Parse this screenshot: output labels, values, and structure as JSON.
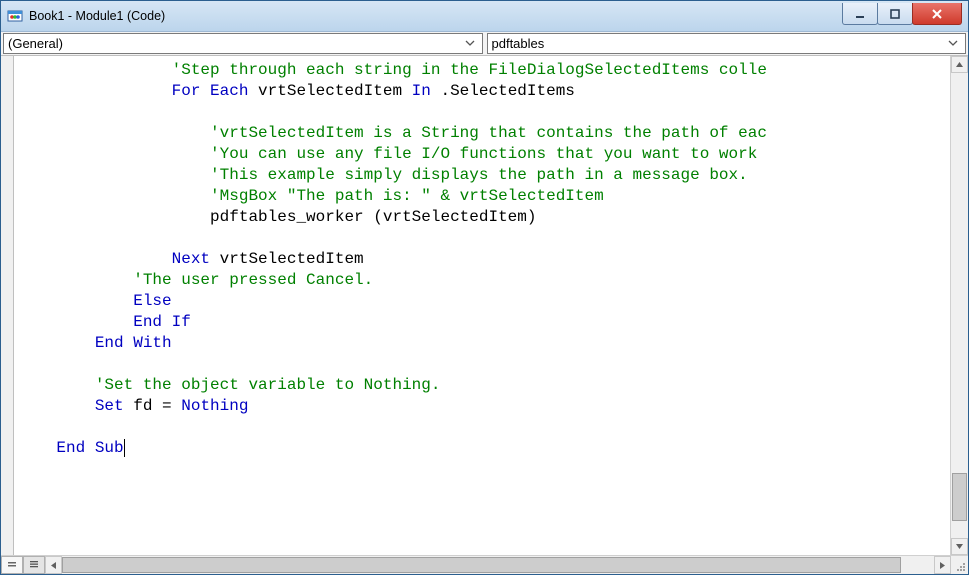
{
  "window": {
    "title": "Book1 - Module1 (Code)"
  },
  "dropdowns": {
    "object": "(General)",
    "procedure": "pdftables"
  },
  "code": {
    "lines": [
      {
        "indent": 16,
        "parts": [
          {
            "c": "comment",
            "t": "'Step through each string in the FileDialogSelectedItems colle"
          }
        ]
      },
      {
        "indent": 16,
        "parts": [
          {
            "c": "keyword",
            "t": "For Each"
          },
          {
            "c": "ident",
            "t": " vrtSelectedItem "
          },
          {
            "c": "keyword",
            "t": "In"
          },
          {
            "c": "ident",
            "t": " .SelectedItems"
          }
        ]
      },
      {
        "indent": 0,
        "parts": []
      },
      {
        "indent": 20,
        "parts": [
          {
            "c": "comment",
            "t": "'vrtSelectedItem is a String that contains the path of eac"
          }
        ]
      },
      {
        "indent": 20,
        "parts": [
          {
            "c": "comment",
            "t": "'You can use any file I/O functions that you want to work"
          }
        ]
      },
      {
        "indent": 20,
        "parts": [
          {
            "c": "comment",
            "t": "'This example simply displays the path in a message box."
          }
        ]
      },
      {
        "indent": 20,
        "parts": [
          {
            "c": "comment",
            "t": "'MsgBox \"The path is: \" & vrtSelectedItem"
          }
        ]
      },
      {
        "indent": 20,
        "parts": [
          {
            "c": "ident",
            "t": "pdftables_worker (vrtSelectedItem)"
          }
        ]
      },
      {
        "indent": 0,
        "parts": []
      },
      {
        "indent": 16,
        "parts": [
          {
            "c": "keyword",
            "t": "Next"
          },
          {
            "c": "ident",
            "t": " vrtSelectedItem"
          }
        ]
      },
      {
        "indent": 12,
        "parts": [
          {
            "c": "comment",
            "t": "'The user pressed Cancel."
          }
        ]
      },
      {
        "indent": 12,
        "parts": [
          {
            "c": "keyword",
            "t": "Else"
          }
        ]
      },
      {
        "indent": 12,
        "parts": [
          {
            "c": "keyword",
            "t": "End If"
          }
        ]
      },
      {
        "indent": 8,
        "parts": [
          {
            "c": "keyword",
            "t": "End With"
          }
        ]
      },
      {
        "indent": 0,
        "parts": []
      },
      {
        "indent": 8,
        "parts": [
          {
            "c": "comment",
            "t": "'Set the object variable to Nothing."
          }
        ]
      },
      {
        "indent": 8,
        "parts": [
          {
            "c": "keyword",
            "t": "Set"
          },
          {
            "c": "ident",
            "t": " fd = "
          },
          {
            "c": "keyword",
            "t": "Nothing"
          }
        ]
      },
      {
        "indent": 0,
        "parts": []
      },
      {
        "indent": 4,
        "parts": [
          {
            "c": "keyword",
            "t": "End Sub"
          }
        ],
        "cursor": true
      }
    ]
  },
  "scroll": {
    "v_thumb_top_pct": 86,
    "v_thumb_height_pct": 10,
    "h_thumb_left_pct": 0,
    "h_thumb_width_pct": 96
  }
}
